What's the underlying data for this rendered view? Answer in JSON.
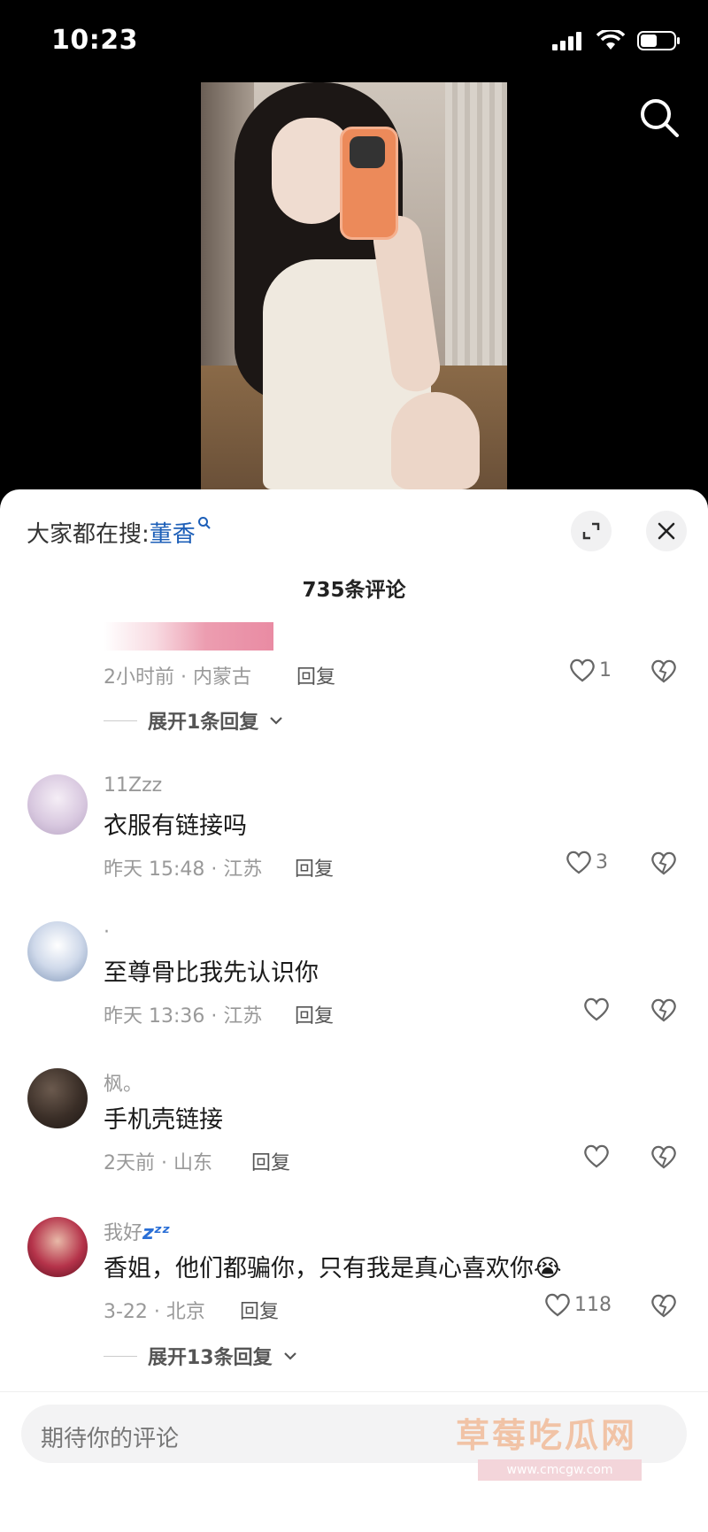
{
  "status_bar": {
    "time": "10:23"
  },
  "sheet": {
    "trending_prefix": "大家都在搜:",
    "trending_keyword": "董香",
    "comment_count": "735条评论",
    "comments": [
      {
        "meta": "2小时前 · 内蒙古",
        "reply": "回复",
        "likes": "1",
        "expand": "展开1条回复"
      },
      {
        "user": "11Zzz",
        "text": "衣服有链接吗",
        "meta": "昨天 15:48 · 江苏",
        "reply": "回复",
        "likes": "3"
      },
      {
        "user": "·",
        "text": "至尊骨比我先认识你",
        "meta": "昨天 13:36 · 江苏",
        "reply": "回复",
        "likes": ""
      },
      {
        "user": "枫。",
        "text": "手机壳链接",
        "meta": "2天前 · 山东",
        "reply": "回复",
        "likes": ""
      },
      {
        "user": "我好",
        "user_emoji": "zᶻᶻ",
        "text": "香姐，他们都骗你，只有我是真心喜欢你",
        "text_emoji": "😭",
        "meta": "3-22 · 北京",
        "reply": "回复",
        "likes": "118",
        "expand": "展开13条回复"
      }
    ],
    "input_placeholder": "期待你的评论",
    "watermark": "草莓吃瓜网",
    "watermark_url": "www.cmcgw.com"
  },
  "colors": {
    "keyword": "#1d5fb8",
    "sheet_bg": "#ffffff",
    "screen_bg": "#000000"
  }
}
